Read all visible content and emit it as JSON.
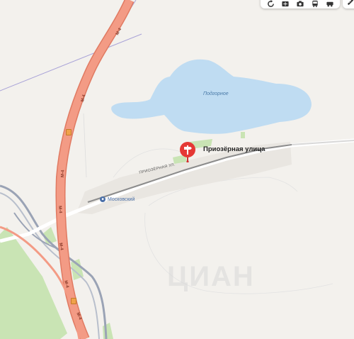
{
  "map": {
    "lake_name": "Подгорное",
    "street_name": "Приозёрная улица",
    "street_road_label": "ПРИОЗЁРНАЯ УЛ.",
    "settlement_name": "Московский",
    "highway_label": "М-4",
    "watermark": "ЦИАН",
    "colors": {
      "background": "#f3f1ed",
      "water": "#bfdcf2",
      "highway": "#f39b85",
      "road": "#ffffff",
      "railway": "#9aa3b5",
      "green": "#c9e4b4",
      "pin": "#e53935",
      "boundary": "#a9a3d8"
    }
  },
  "toolbar": {
    "icons": [
      "rotate-icon",
      "panorama-icon",
      "camera-icon",
      "transit-icon",
      "traffic-icon"
    ],
    "ruler_icon": "ruler-icon"
  },
  "marker": {
    "icon": "signpost-icon"
  }
}
